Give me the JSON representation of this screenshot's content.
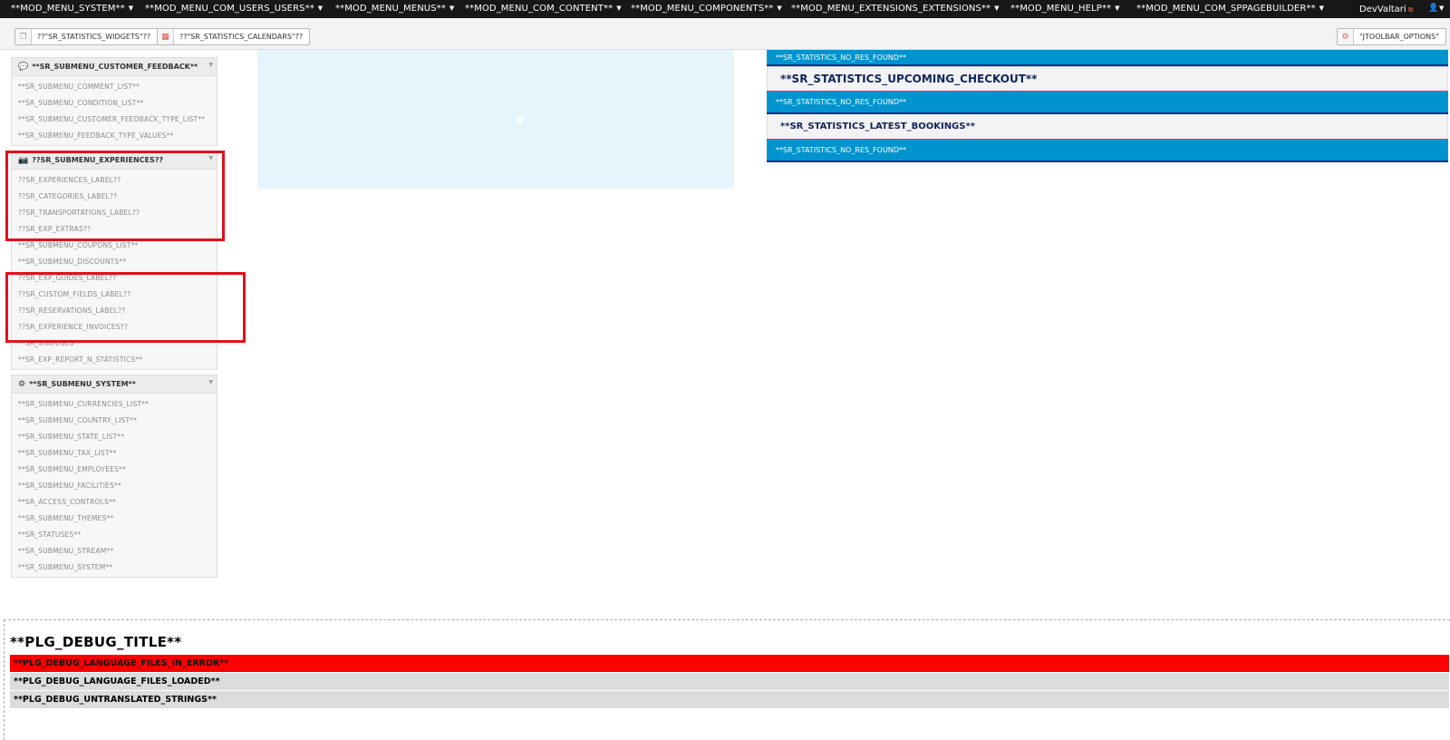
{
  "navbar": {
    "items": [
      "**MOD_MENU_SYSTEM**",
      "**MOD_MENU_COM_USERS_USERS**",
      "**MOD_MENU_MENUS**",
      "**MOD_MENU_COM_CONTENT**",
      "**MOD_MENU_COMPONENTS**",
      "**MOD_MENU_EXTENSIONS_EXTENSIONS**",
      "**MOD_MENU_HELP**",
      "**MOD_MENU_COM_SPPAGEBUILDER**"
    ],
    "caret": "▼",
    "user_name": "DevValtari",
    "external_glyph": "⧉",
    "user_glyph": "👤"
  },
  "toolbar": {
    "widgets_label": "??\"SR_STATISTICS_WIDGETS\"??",
    "calendars_label": "??\"SR_STATISTICS_CALENDARS\"??",
    "options_label": "\"JTOOLBAR_OPTIONS\""
  },
  "sidebar": {
    "feedback": {
      "title": "**SR_SUBMENU_CUSTOMER_FEEDBACK**",
      "items": [
        "**SR_SUBMENU_COMMENT_LIST**",
        "**SR_SUBMENU_CONDITION_LIST**",
        "**SR_SUBMENU_CUSTOMER_FEEDBACK_TYPE_LIST**",
        "**SR_SUBMENU_FEEDBACK_TYPE_VALUES**"
      ]
    },
    "experiences": {
      "title": "??SR_SUBMENU_EXPERIENCES??",
      "items": [
        "??SR_EXPERIENCES_LABEL??",
        "??SR_CATEGORIES_LABEL??",
        "??SR_TRANSPORTATIONS_LABEL??",
        "??SR_EXP_EXTRAS??",
        "**SR_SUBMENU_COUPONS_LIST**",
        "**SR_SUBMENU_DISCOUNTS**",
        "??SR_EXP_GUIDES_LABEL??",
        "??SR_CUSTOM_FIELDS_LABEL??",
        "??SR_RESERVATIONS_LABEL??",
        "??SR_EXPERIENCE_INVOICES??",
        "**SR_STATUSES**",
        "**SR_EXP_REPORT_N_STATISTICS**"
      ]
    },
    "system": {
      "title": "**SR_SUBMENU_SYSTEM**",
      "items": [
        "**SR_SUBMENU_CURRENCIES_LIST**",
        "**SR_SUBMENU_COUNTRY_LIST**",
        "**SR_SUBMENU_STATE_LIST**",
        "**SR_SUBMENU_TAX_LIST**",
        "**SR_SUBMENU_EMPLOYEES**",
        "**SR_SUBMENU_FACILITIES**",
        "**SR_ACCESS_CONTROLS**",
        "**SR_SUBMENU_THEMES**",
        "**SR_STATUSES**",
        "**SR_SUBMENU_STREAM**",
        "**SR_SUBMENU_SYSTEM**"
      ]
    }
  },
  "stats": {
    "no_res_1": "**SR_STATISTICS_NO_RES_FOUND**",
    "upcoming_checkout_title": "**SR_STATISTICS_UPCOMING_CHECKOUT**",
    "no_res_2": "**SR_STATISTICS_NO_RES_FOUND**",
    "latest_bookings_title": "**SR_STATISTICS_LATEST_BOOKINGS**",
    "no_res_3": "**SR_STATISTICS_NO_RES_FOUND**"
  },
  "debug": {
    "title": "**PLG_DEBUG_TITLE**",
    "errors": "**PLG_DEBUG_LANGUAGE_FILES_IN_ERROR**",
    "loaded": "**PLG_DEBUG_LANGUAGE_FILES_LOADED**",
    "untranslated": "**PLG_DEBUG_UNTRANSLATED_STRINGS**"
  },
  "colors": {
    "navbar_bg": "#171717",
    "stat_bar": "#0094cf",
    "highlight_box": "#e0111d",
    "debug_error": "#ff0000"
  }
}
